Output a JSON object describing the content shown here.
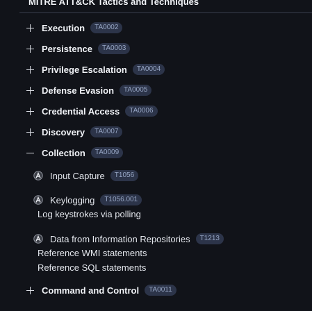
{
  "header": {
    "title": "MITRE ATT&CK Tactics and Techniques"
  },
  "tactics": [
    {
      "label": "Execution",
      "id": "TA0002"
    },
    {
      "label": "Persistence",
      "id": "TA0003"
    },
    {
      "label": "Privilege Escalation",
      "id": "TA0004"
    },
    {
      "label": "Defense Evasion",
      "id": "TA0005"
    },
    {
      "label": "Credential Access",
      "id": "TA0006"
    },
    {
      "label": "Discovery",
      "id": "TA0007"
    },
    {
      "label": "Collection",
      "id": "TA0009",
      "expanded": true
    },
    {
      "label": "Command and Control",
      "id": "TA0011"
    }
  ],
  "techniques": [
    {
      "label": "Input Capture",
      "id": "T1056"
    },
    {
      "label": "Keylogging",
      "id": "T1056.001",
      "procedures": [
        "Log keystrokes via polling"
      ]
    },
    {
      "label": "Data from Information Repositories",
      "id": "T1213",
      "procedures": [
        "Reference WMI statements",
        "Reference SQL statements"
      ]
    }
  ],
  "icons": {
    "expand": "plus-icon",
    "collapse": "minus-icon",
    "technique": "attack-logo-icon"
  },
  "colors": {
    "background": "#111319",
    "badge_bg": "#2c3449",
    "badge_text": "#97a6c4"
  }
}
